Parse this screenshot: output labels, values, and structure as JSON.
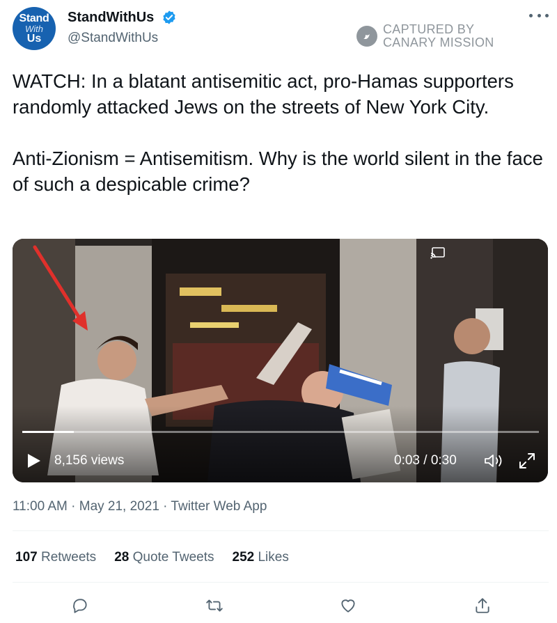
{
  "author": {
    "avatar_lines": [
      "Stand",
      "With",
      "Us"
    ],
    "display_name": "StandWithUs",
    "handle": "@StandWithUs",
    "verified": true
  },
  "watermark": {
    "line1": "CAPTURED BY",
    "line2": "CANARY MISSION"
  },
  "tweet": {
    "paragraphs": [
      "WATCH: In a blatant antisemitic act, pro-Hamas supporters randomly attacked Jews on the streets of New York City.",
      "Anti-Zionism = Antisemitism. Why is the world silent in the face of such a despicable crime?"
    ]
  },
  "video": {
    "views": "8,156 views",
    "time": "0:03 / 0:30",
    "progress": 0.1,
    "annotation": "red arrow pointing at a person in the video"
  },
  "meta": {
    "timestamp": "11:00 AM · May 21, 2021 · Twitter Web App"
  },
  "stats": [
    {
      "count": "107",
      "label": "Retweets"
    },
    {
      "count": "28",
      "label": "Quote Tweets"
    },
    {
      "count": "252",
      "label": "Likes"
    }
  ],
  "actions": [
    "reply-icon",
    "retweet-icon",
    "like-icon",
    "share-icon"
  ],
  "colors": {
    "text": "#0f1419",
    "secondary": "#536471",
    "verified": "#1d9bf0",
    "avatar": "#1762b0",
    "arrow": "#e0302b"
  }
}
